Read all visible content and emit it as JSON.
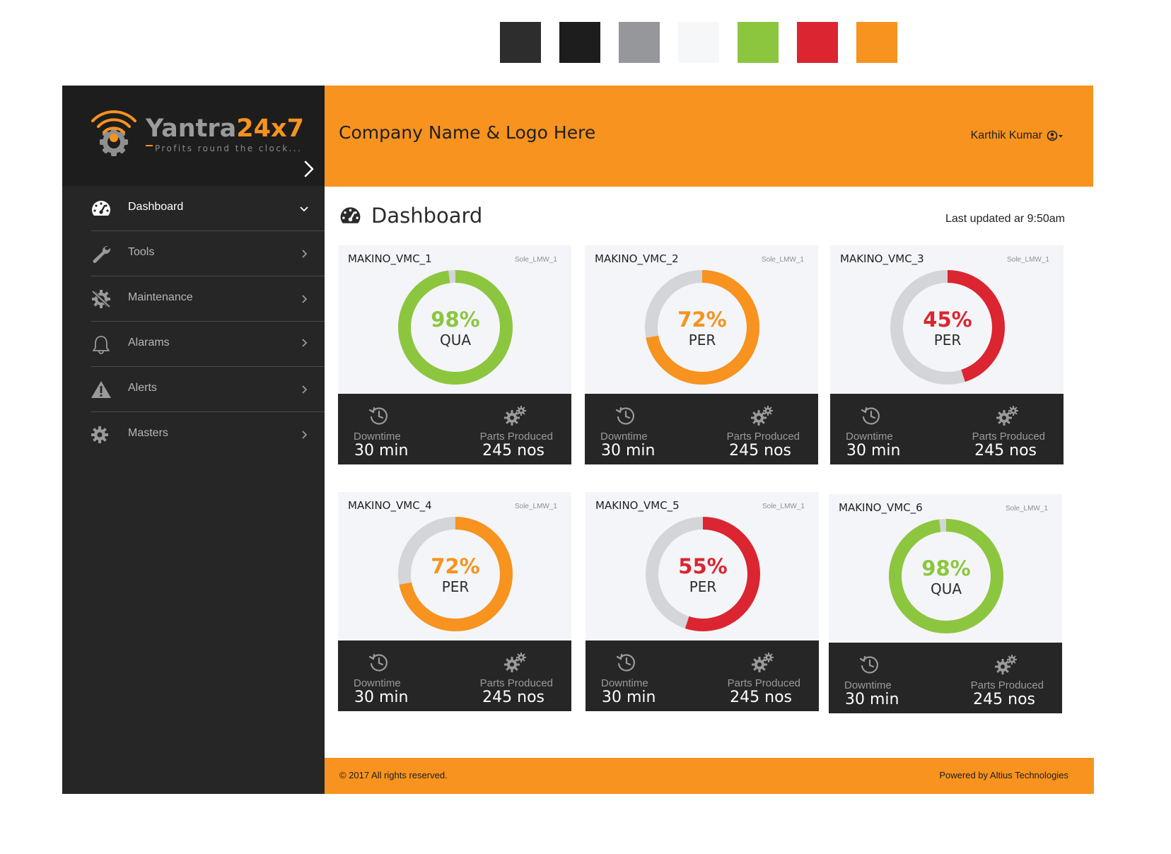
{
  "palette": [
    "#2d2d2d",
    "#1d1d1d",
    "#96979a",
    "#f6f7f9",
    "#8cc63f",
    "#db2530",
    "#f7931e"
  ],
  "colors": {
    "accent": "#f7931e",
    "good": "#8cc63f",
    "warn": "#f7931e",
    "bad": "#db2530",
    "track": "#d4d5d8"
  },
  "brand": {
    "name_part1": "Yantra",
    "name_part2": "24x7",
    "tagline": "Profits round the clock..."
  },
  "sidebar": {
    "items": [
      {
        "label": "Dashboard",
        "icon": "dashboard-icon",
        "active": true,
        "arrow": "chevron-down-icon"
      },
      {
        "label": "Tools",
        "icon": "wrench-icon",
        "active": false,
        "arrow": "chevron-right-icon"
      },
      {
        "label": "Maintenance",
        "icon": "maintenance-gear-icon",
        "active": false,
        "arrow": "chevron-right-icon"
      },
      {
        "label": "Alarams",
        "icon": "bell-icon",
        "active": false,
        "arrow": "chevron-right-icon"
      },
      {
        "label": "Alerts",
        "icon": "warning-icon",
        "active": false,
        "arrow": "chevron-right-icon"
      },
      {
        "label": "Masters",
        "icon": "gear-icon",
        "active": false,
        "arrow": "chevron-right-icon"
      }
    ]
  },
  "header": {
    "company": "Company Name & Logo Here",
    "user_name": "Karthik Kumar"
  },
  "main": {
    "title": "Dashboard",
    "last_updated": "Last updated ar 9:50am"
  },
  "labels": {
    "downtime": "Downtime",
    "parts_produced": "Parts Produced"
  },
  "machines": [
    {
      "name": "MAKINO_VMC_1",
      "shift": "Sole_LMW_1",
      "percent": 98,
      "percent_label": "98%",
      "metric": "QUA",
      "status": "good",
      "downtime": "30 min",
      "parts": "245 nos"
    },
    {
      "name": "MAKINO_VMC_2",
      "shift": "Sole_LMW_1",
      "percent": 72,
      "percent_label": "72%",
      "metric": "PER",
      "status": "warn",
      "downtime": "30 min",
      "parts": "245 nos"
    },
    {
      "name": "MAKINO_VMC_3",
      "shift": "Sole_LMW_1",
      "percent": 45,
      "percent_label": "45%",
      "metric": "PER",
      "status": "bad",
      "downtime": "30 min",
      "parts": "245 nos"
    },
    {
      "name": "MAKINO_VMC_4",
      "shift": "Sole_LMW_1",
      "percent": 72,
      "percent_label": "72%",
      "metric": "PER",
      "status": "warn",
      "downtime": "30 min",
      "parts": "245 nos"
    },
    {
      "name": "MAKINO_VMC_5",
      "shift": "Sole_LMW_1",
      "percent": 55,
      "percent_label": "55%",
      "metric": "PER",
      "status": "bad",
      "downtime": "30 min",
      "parts": "245 nos"
    },
    {
      "name": "MAKINO_VMC_6",
      "shift": "Sole_LMW_1",
      "percent": 98,
      "percent_label": "98%",
      "metric": "QUA",
      "status": "good",
      "downtime": "30 min",
      "parts": "245 nos"
    }
  ],
  "footer": {
    "copyright": "© 2017 All rights reserved.",
    "powered_by": "Powered by Altius Technologies"
  }
}
